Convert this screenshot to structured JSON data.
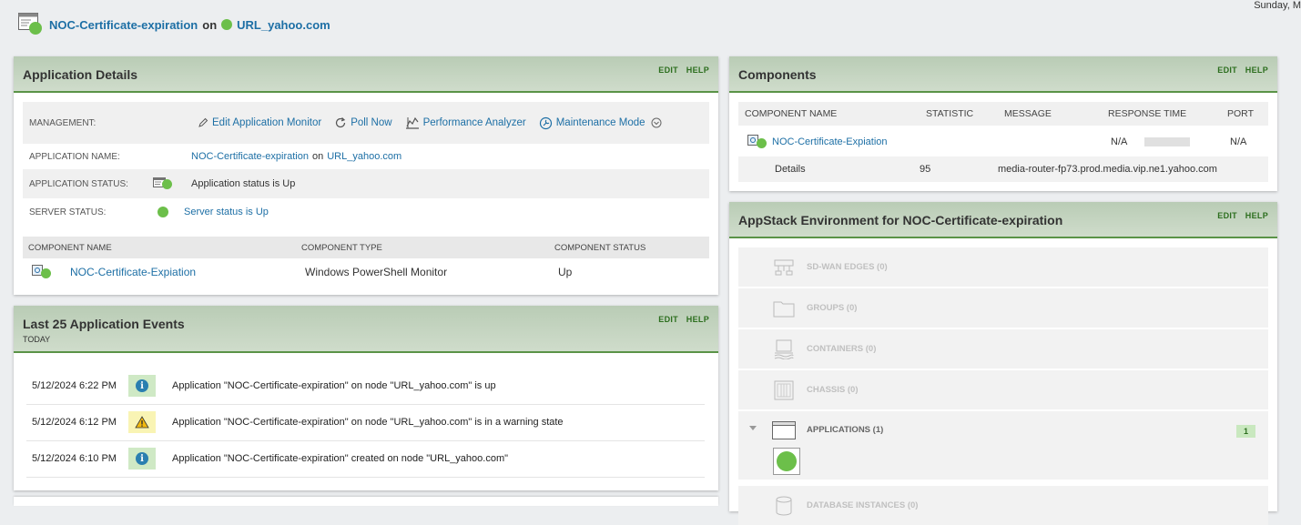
{
  "header": {
    "date": "Sunday, M",
    "app_link": "NOC-Certificate-expiration",
    "on": "on",
    "node_link": "URL_yahoo.com"
  },
  "colors": {
    "status_up": "#6cbf4a",
    "accent_link": "#1d6fa5",
    "header_green": "#b9ccb5"
  },
  "app_details": {
    "title": "Application Details",
    "edit": "EDIT",
    "help": "HELP",
    "management_label": "MANAGEMENT:",
    "management": {
      "edit_monitor": "Edit Application Monitor",
      "poll_now": "Poll Now",
      "perf_analyzer": "Performance Analyzer",
      "maintenance": "Maintenance Mode"
    },
    "app_name_label": "APPLICATION NAME:",
    "app_name": "NOC-Certificate-expiration",
    "app_name_on": "on",
    "app_name_node": "URL_yahoo.com",
    "app_status_label": "APPLICATION STATUS:",
    "app_status": "Application status is Up",
    "server_status_label": "SERVER STATUS:",
    "server_status": "Server status is Up",
    "table": {
      "headers": [
        "COMPONENT NAME",
        "COMPONENT TYPE",
        "COMPONENT STATUS"
      ],
      "row": {
        "name": "NOC-Certificate-Expiation",
        "type": "Windows PowerShell Monitor",
        "status": "Up"
      }
    }
  },
  "events": {
    "title": "Last 25 Application Events",
    "subtitle": "TODAY",
    "edit": "EDIT",
    "help": "HELP",
    "rows": [
      {
        "time": "5/12/2024 6:22 PM",
        "icon": "info-icon",
        "message": "Application \"NOC-Certificate-expiration\" on node \"URL_yahoo.com\" is up"
      },
      {
        "time": "5/12/2024 6:12 PM",
        "icon": "warning-icon",
        "message": "Application \"NOC-Certificate-expiration\" on node \"URL_yahoo.com\" is in a warning state"
      },
      {
        "time": "5/12/2024 6:10 PM",
        "icon": "info-icon",
        "message": "Application \"NOC-Certificate-expiration\" created on node \"URL_yahoo.com\""
      }
    ]
  },
  "components": {
    "title": "Components",
    "edit": "EDIT",
    "help": "HELP",
    "headers": [
      "COMPONENT NAME",
      "STATISTIC",
      "MESSAGE",
      "RESPONSE TIME",
      "PORT"
    ],
    "row": {
      "name": "NOC-Certificate-Expiation",
      "statistic": "",
      "message": "",
      "response_time": "N/A",
      "port": "N/A"
    },
    "details": {
      "label": "Details",
      "statistic": "95",
      "message": "media-router-fp73.prod.media.vip.ne1.yahoo.com"
    }
  },
  "appstack": {
    "title": "AppStack Environment for NOC-Certificate-expiration",
    "edit": "EDIT",
    "help": "HELP",
    "items": [
      {
        "label": "SD-WAN EDGES (0)",
        "icon": "sdwan-icon"
      },
      {
        "label": "GROUPS (0)",
        "icon": "folder-icon"
      },
      {
        "label": "CONTAINERS (0)",
        "icon": "container-icon"
      },
      {
        "label": "CHASSIS (0)",
        "icon": "chassis-icon"
      },
      {
        "label": "APPLICATIONS (1)",
        "icon": "application-icon",
        "count": "1"
      },
      {
        "label": "DATABASE INSTANCES (0)",
        "icon": "database-icon"
      }
    ]
  }
}
